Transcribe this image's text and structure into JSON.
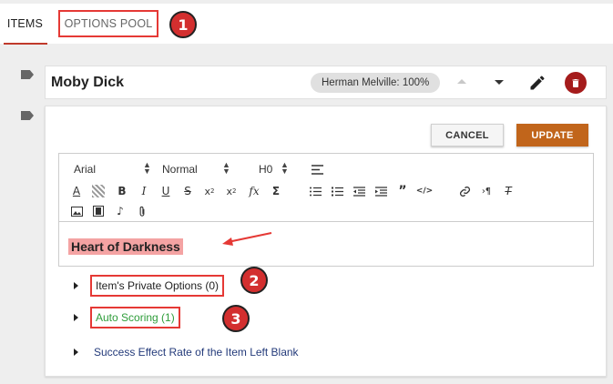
{
  "tabs": [
    {
      "label": "ITEMS"
    },
    {
      "label": "OPTIONS POOL"
    }
  ],
  "badges": [
    "1",
    "2",
    "3"
  ],
  "item": {
    "title": "Moby Dick",
    "author_chip": "Herman Melville: 100%"
  },
  "editor": {
    "cancel_label": "CANCEL",
    "update_label": "UPDATE",
    "font": "Arial",
    "size": "Normal",
    "heading": "H0",
    "content": "Heart of Darkness"
  },
  "sections": {
    "private_options": "Item's Private Options (0)",
    "auto_scoring": "Auto Scoring (1)",
    "success_rate": "Success Effect Rate of the Item Left Blank"
  },
  "colors": {
    "accent_red": "#d32f2f",
    "update_orange": "#c1651b",
    "auto_green": "#2e9d3a",
    "highlight": "#f4a3a3"
  }
}
